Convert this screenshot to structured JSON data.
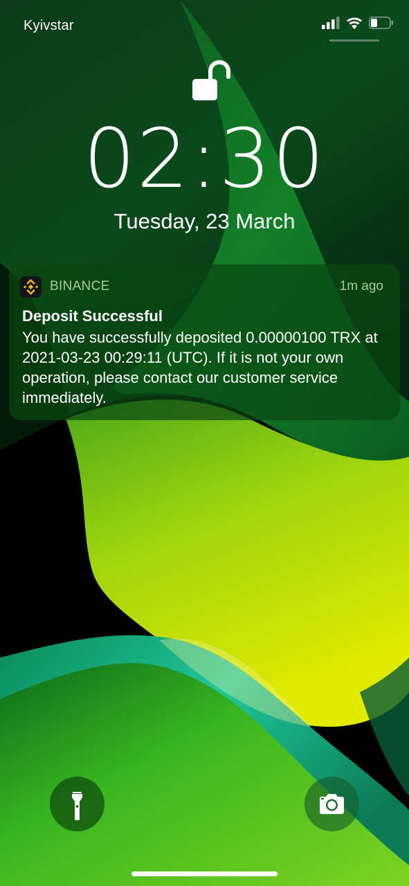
{
  "status_bar": {
    "carrier": "Kyivstar"
  },
  "lock_screen": {
    "time": "02:30",
    "date": "Tuesday, 23 March"
  },
  "notification": {
    "app_name": "BINANCE",
    "app_icon": "binance-logo",
    "time_ago": "1m ago",
    "title": "Deposit Successful",
    "body": "You have successfully deposited 0.00000100 TRX at 2021-03-23 00:29:11 (UTC). If it is not your own operation, please contact our customer service immediately."
  },
  "quick_actions": {
    "left_icon": "flashlight-icon",
    "right_icon": "camera-icon"
  },
  "colors": {
    "notification_bg": "#0a4614",
    "binance_yellow": "#f0b90b",
    "wallpaper_lime": "#c8e400",
    "wallpaper_green": "#22a82a",
    "wallpaper_teal": "#1fc79a"
  }
}
